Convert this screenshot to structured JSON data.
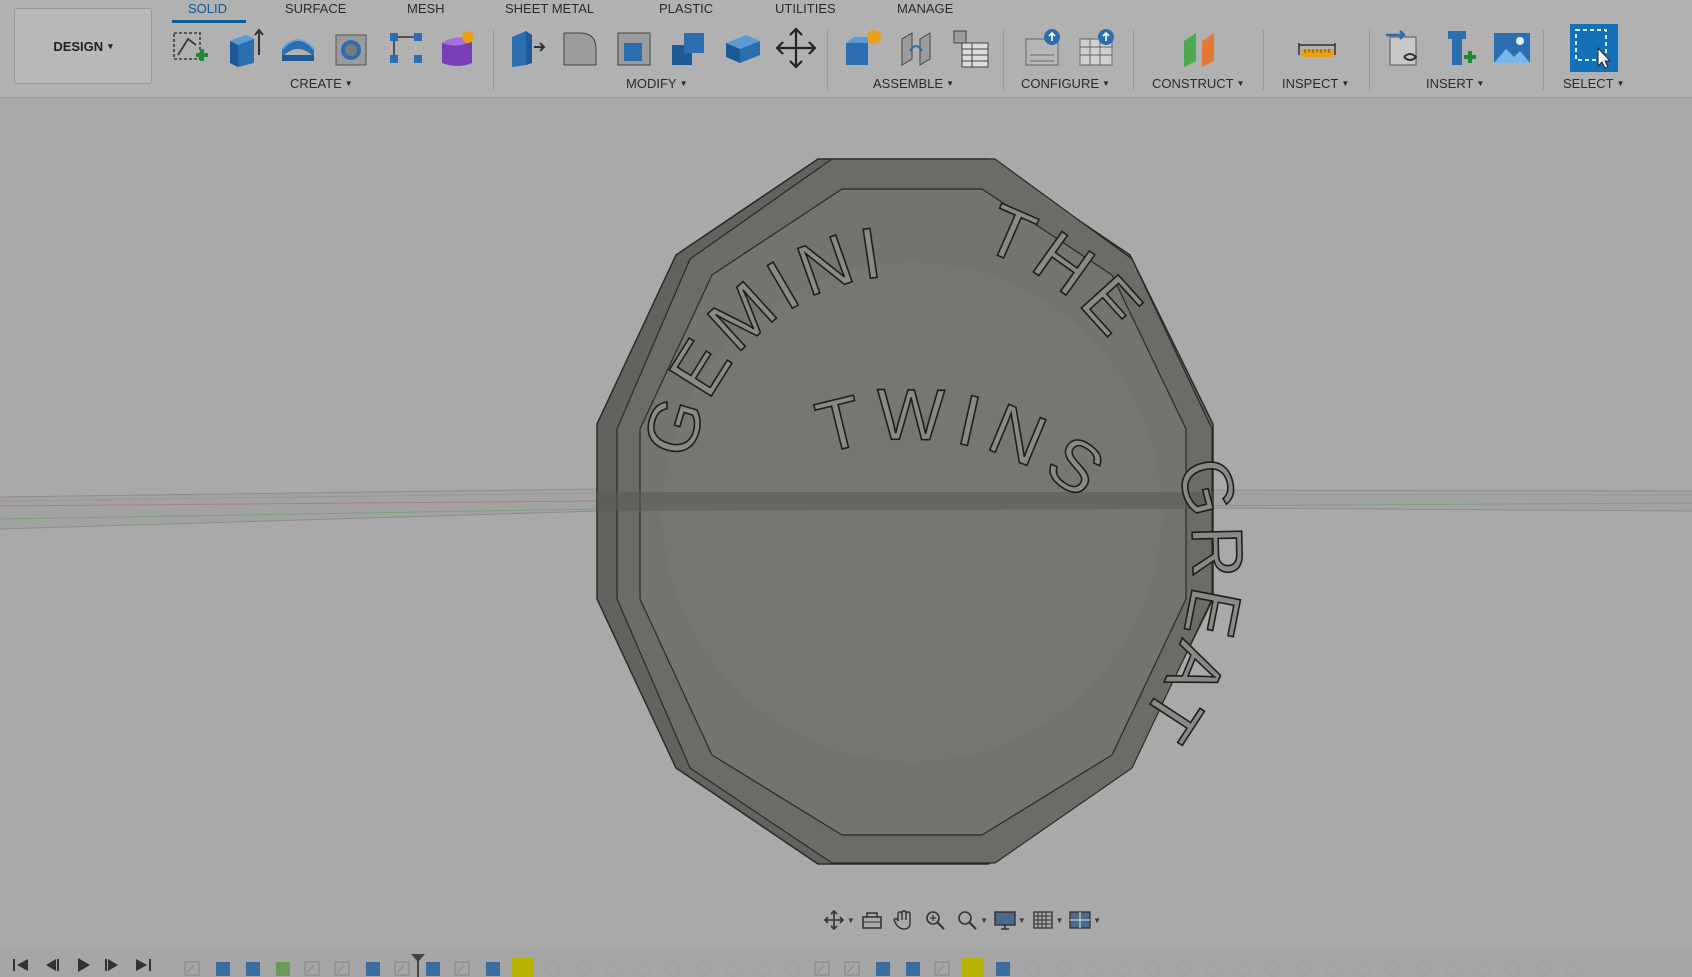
{
  "workspace": {
    "label": "DESIGN",
    "caret": "▾"
  },
  "tabs": [
    {
      "id": "solid",
      "label": "SOLID",
      "active": true
    },
    {
      "id": "surface",
      "label": "SURFACE",
      "active": false
    },
    {
      "id": "mesh",
      "label": "MESH",
      "active": false
    },
    {
      "id": "sheet-metal",
      "label": "SHEET METAL",
      "active": false
    },
    {
      "id": "plastic",
      "label": "PLASTIC",
      "active": false
    },
    {
      "id": "utilities",
      "label": "UTILITIES",
      "active": false
    },
    {
      "id": "manage",
      "label": "MANAGE",
      "active": false
    }
  ],
  "groups": {
    "create": "CREATE",
    "modify": "MODIFY",
    "assemble": "ASSEMBLE",
    "configure": "CONFIGURE",
    "construct": "CONSTRUCT",
    "inspect": "INSPECT",
    "insert": "INSERT",
    "select": "SELECT"
  },
  "tools": {
    "create": [
      "create-sketch-icon",
      "extrude-icon",
      "revolve-icon",
      "hole-icon",
      "pattern-icon",
      "form-icon"
    ],
    "modify": [
      "press-pull-icon",
      "fillet-icon",
      "shell-icon",
      "combine-icon",
      "offset-face-icon",
      "move-icon"
    ],
    "assemble": [
      "new-component-icon",
      "joint-icon",
      "bill-of-materials-icon"
    ],
    "configure": [
      "configure-icon",
      "configuration-table-icon"
    ],
    "construct": [
      "offset-plane-icon"
    ],
    "inspect": [
      "measure-icon"
    ],
    "insert": [
      "insert-derive-icon",
      "insert-mcmaster-icon",
      "insert-canvas-icon"
    ],
    "select": [
      "select-window-icon"
    ]
  },
  "model": {
    "text_top_left": "GEMINI",
    "text_top_right": "THE",
    "text_right": "GREAT",
    "text_bottom": "TWINS",
    "body_color": "#6c6c66",
    "face_color": "#7d7d78"
  },
  "navbar": [
    "orbit-icon",
    "look-at-icon",
    "pan-icon",
    "zoom-icon",
    "fit-icon",
    "display-settings-icon",
    "grid-icon",
    "viewports-icon"
  ],
  "colors": {
    "accent": "#0d5c95",
    "toolbar_bg": "#b1b1b1",
    "canvas_bg": "#a9a9a9",
    "timeline_highlight": "#b8b300"
  }
}
